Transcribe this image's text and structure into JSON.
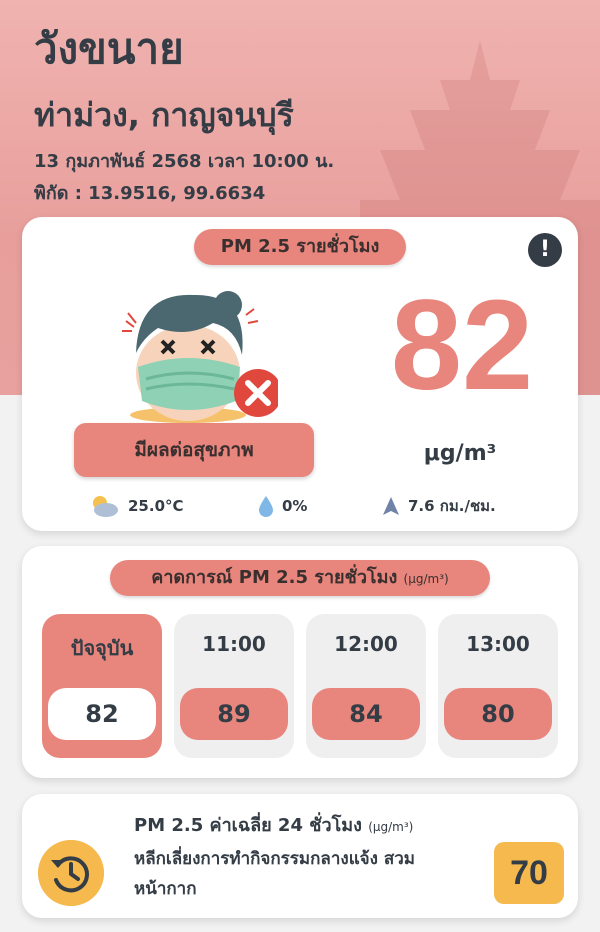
{
  "location": {
    "name": "วังขนาย",
    "district": "ท่าม่วง, กาญจนบุรี",
    "datetime": "13 กุมภาพันธ์ 2568  เวลา 10:00 น.",
    "coordinates": "พิกัด : 13.9516, 99.6634"
  },
  "current": {
    "title": "PM 2.5 รายชั่วโมง",
    "info_icon": "!",
    "value": "82",
    "unit": "μg/m³",
    "status": "มีผลต่อสุขภาพ",
    "status_color": "#e8857c",
    "weather": {
      "temperature": "25.0°C",
      "rain": "0%",
      "wind": "7.6 กม./ชม."
    }
  },
  "forecast": {
    "title": "คาดการณ์ PM 2.5 รายชั่วโมง",
    "title_unit": "(μg/m³)",
    "items": [
      {
        "time": "ปัจจุบัน",
        "value": "82"
      },
      {
        "time": "11:00",
        "value": "89"
      },
      {
        "time": "12:00",
        "value": "84"
      },
      {
        "time": "13:00",
        "value": "80"
      }
    ]
  },
  "average": {
    "title": "PM 2.5 ค่าเฉลี่ย 24 ชั่วโมง",
    "title_unit": "(μg/m³)",
    "advice": "หลีกเลี่ยงการทำกิจกรรมกลางแจ้ง สวมหน้ากาก",
    "value": "70",
    "color": "#f5b94e"
  },
  "colors": {
    "header": "#e89f9c",
    "accent": "#e8857c",
    "dark_text": "#343c45"
  }
}
